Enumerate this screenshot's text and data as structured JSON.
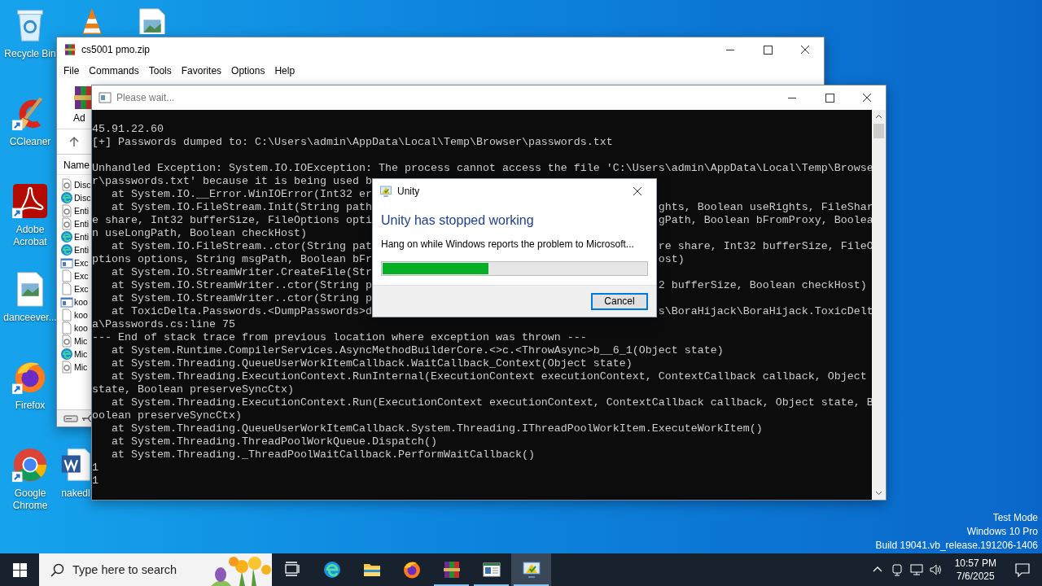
{
  "desktop_icons": [
    {
      "kind": "recycle-bin",
      "label": "Recycle Bin",
      "shortcut": false
    },
    {
      "kind": "cone",
      "shortcut": false
    },
    {
      "kind": "image-file",
      "shortcut": false
    },
    {
      "kind": "cleaner",
      "label": "CCleaner",
      "shortcut": true
    },
    {
      "kind": "pdf-reader",
      "label": "Adobe\nAcrobat",
      "shortcut": true
    },
    {
      "kind": "image-file",
      "label": "danceever...",
      "shortcut": false
    },
    {
      "kind": "fox-browser",
      "label": "Firefox",
      "shortcut": true
    },
    {
      "kind": "round-browser",
      "label": "Google\nChrome",
      "shortcut": true
    },
    {
      "kind": "word-doc",
      "label": "nakedl",
      "shortcut": false
    }
  ],
  "archive_window": {
    "title": "cs5001 pmo.zip",
    "menu": [
      "File",
      "Commands",
      "Tools",
      "Favorites",
      "Options",
      "Help"
    ],
    "toolbar_label": "Ad",
    "column_header": "Name",
    "files": [
      {
        "name": "Disc",
        "kind": "gear"
      },
      {
        "name": "Disc",
        "kind": "edge"
      },
      {
        "name": "Enti",
        "kind": "gear"
      },
      {
        "name": "Enti",
        "kind": "gear"
      },
      {
        "name": "Enti",
        "kind": "edge"
      },
      {
        "name": "Enti",
        "kind": "edge"
      },
      {
        "name": "Exc",
        "kind": "app"
      },
      {
        "name": "Exc",
        "kind": "blank"
      },
      {
        "name": "Exc",
        "kind": "blank"
      },
      {
        "name": "koo",
        "kind": "app"
      },
      {
        "name": "koo",
        "kind": "blank"
      },
      {
        "name": "koo",
        "kind": "blank"
      },
      {
        "name": "Mic",
        "kind": "gear"
      },
      {
        "name": "Mic",
        "kind": "edge"
      },
      {
        "name": "Mic",
        "kind": "gear"
      }
    ]
  },
  "console_window": {
    "title": "Please wait...",
    "lines": [
      {
        "kind": "text",
        "text": "45.91.22.60"
      },
      {
        "kind": "text",
        "text": "[+] Passwords dumped to: C:\\Users\\admin\\AppData\\Local\\Temp\\Browser\\passwords.txt"
      },
      {
        "kind": "blank"
      },
      {
        "kind": "text",
        "text": "Unhandled Exception: System.IO.IOException: The process cannot access the file 'C:\\Users\\admin\\AppData\\Local\\Temp\\Browse"
      },
      {
        "kind": "text",
        "text": "r\\passwords.txt' because it is being used b"
      },
      {
        "kind": "text",
        "text": "   at System.IO.__Error.WinIOError(Int32 er"
      },
      {
        "kind": "text",
        "text": "   at System.IO.FileStream.Init(String path",
        "right": "ghts, Boolean useRights, FileShar"
      },
      {
        "kind": "text",
        "text": "e share, Int32 bufferSize, FileOptions opti",
        "right": "gPath, Boolean bFromProxy, Boolea"
      },
      {
        "kind": "text",
        "text": "n useLongPath, Boolean checkHost)"
      },
      {
        "kind": "text",
        "text": "   at System.IO.FileStream..ctor(String pat",
        "right": "re share, Int32 bufferSize, FileO"
      },
      {
        "kind": "text",
        "text": "ptions options, String msgPath, Boolean bFr",
        "right": "ost)"
      },
      {
        "kind": "text",
        "text": "   at System.IO.StreamWriter.CreateFile(Str"
      },
      {
        "kind": "text",
        "text": "   at System.IO.StreamWriter..ctor(String p",
        "right": "2 bufferSize, Boolean checkHost)"
      },
      {
        "kind": "text",
        "text": "   at System.IO.StreamWriter..ctor(String p"
      },
      {
        "kind": "text",
        "text": "   at ToxicDelta.Passwords.<DumpPasswords>d",
        "right": "s\\BoraHijack\\BoraHijack.ToxicDelt"
      },
      {
        "kind": "text",
        "text": "a\\Passwords.cs:line 75"
      },
      {
        "kind": "text",
        "text": "--- End of stack trace from previous location where exception was thrown ---"
      },
      {
        "kind": "text",
        "text": "   at System.Runtime.CompilerServices.AsyncMethodBuilderCore.<>c.<ThrowAsync>b__6_1(Object state)"
      },
      {
        "kind": "text",
        "text": "   at System.Threading.QueueUserWorkItemCallback.WaitCallback_Context(Object state)"
      },
      {
        "kind": "text",
        "text": "   at System.Threading.ExecutionContext.RunInternal(ExecutionContext executionContext, ContextCallback callback, Object"
      },
      {
        "kind": "text",
        "text": "state, Boolean preserveSyncCtx)"
      },
      {
        "kind": "text",
        "text": "   at System.Threading.ExecutionContext.Run(ExecutionContext executionContext, ContextCallback callback, Object state, B"
      },
      {
        "kind": "text",
        "text": "oolean preserveSyncCtx)"
      },
      {
        "kind": "text",
        "text": "   at System.Threading.QueueUserWorkItemCallback.System.Threading.IThreadPoolWorkItem.ExecuteWorkItem()"
      },
      {
        "kind": "text",
        "text": "   at System.Threading.ThreadPoolWorkQueue.Dispatch()"
      },
      {
        "kind": "text",
        "text": "   at System.Threading._ThreadPoolWaitCallback.PerformWaitCallback()"
      },
      {
        "kind": "text",
        "text": "1"
      },
      {
        "kind": "text",
        "text": "1"
      }
    ]
  },
  "dialog": {
    "title": "Unity",
    "heading": "Unity has stopped working",
    "message": "Hang on while Windows reports the problem to Microsoft...",
    "progress": {
      "level": 0.4
    },
    "buttons": [
      {
        "label": "Cancel",
        "default": true
      }
    ]
  },
  "system_watermark": [
    "Test Mode",
    "Windows 10 Pro",
    "Build 19041.vb_release.191206-1406"
  ],
  "taskbar": {
    "search": {
      "placeholder": "Type here to search"
    },
    "apps": [
      {
        "kind": "task-view",
        "running": false,
        "selected": false
      },
      {
        "kind": "edge",
        "running": false,
        "selected": false
      },
      {
        "kind": "folder",
        "running": false,
        "selected": false
      },
      {
        "kind": "fox-browser",
        "running": false,
        "selected": false
      },
      {
        "kind": "archiver",
        "running": true,
        "selected": false
      },
      {
        "kind": "app-window",
        "running": true,
        "selected": false
      },
      {
        "kind": "crash-monitor",
        "running": true,
        "selected": true
      }
    ],
    "clock": {
      "time": "10:57 PM",
      "date": "7/6/2025"
    }
  }
}
